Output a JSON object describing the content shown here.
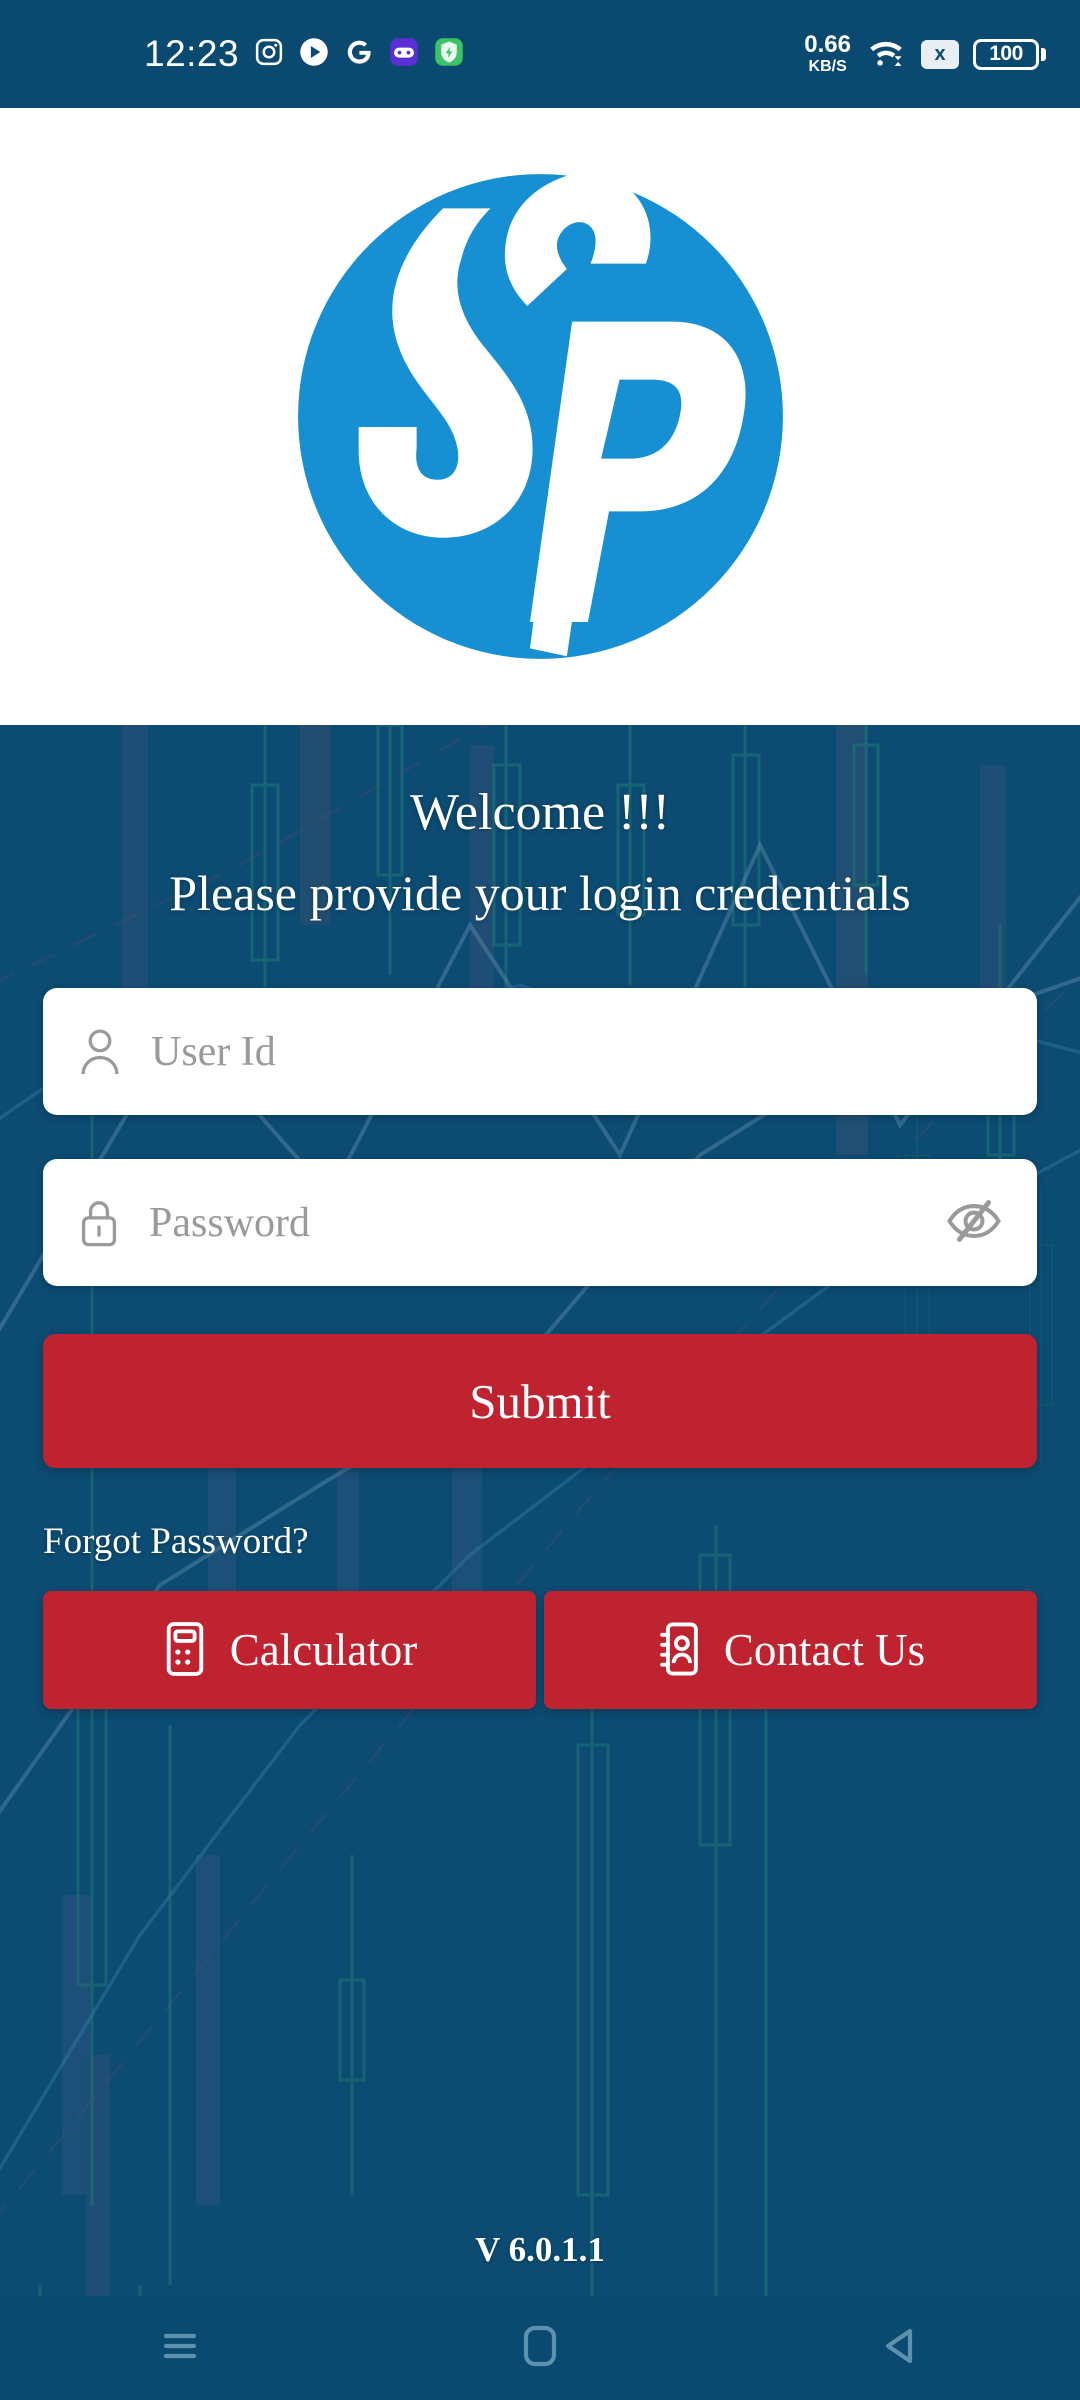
{
  "status_bar": {
    "time": "12:23",
    "left_icons": [
      {
        "name": "instagram-icon",
        "label": "Instagram"
      },
      {
        "name": "play-icon",
        "label": "Play"
      },
      {
        "name": "google-icon",
        "label": "Google"
      },
      {
        "name": "game-controller-icon",
        "label": "Game Controller"
      },
      {
        "name": "shield-bolt-icon",
        "label": "Security Booster"
      }
    ],
    "network_speed_value": "0.66",
    "network_speed_unit": "KB/S",
    "wifi_icon": "wifi-icon",
    "sim_icon_label": "x",
    "battery_level": "100"
  },
  "logo": {
    "name": "sp-logo",
    "alt": "SP",
    "circle_color": "#1690d3",
    "mark_color": "#ffffff"
  },
  "header": {
    "welcome": "Welcome !!!",
    "subtitle": "Please provide your login credentials"
  },
  "form": {
    "user_id": {
      "placeholder": "User Id",
      "value": "",
      "icon": "person-icon"
    },
    "password": {
      "placeholder": "Password",
      "value": "",
      "icon": "lock-icon",
      "toggle_icon": "eye-slash-icon",
      "visible": false
    },
    "submit_label": "Submit",
    "forgot_password_label": "Forgot Password?"
  },
  "actions": [
    {
      "label": "Calculator",
      "icon": "calculator-icon"
    },
    {
      "label": "Contact Us",
      "icon": "contact-book-icon"
    }
  ],
  "footer": {
    "version": "V 6.0.1.1"
  },
  "nav_bar": [
    {
      "name": "recents-button",
      "icon": "menu-lines-icon"
    },
    {
      "name": "home-button",
      "icon": "rounded-square-icon"
    },
    {
      "name": "back-button",
      "icon": "triangle-left-icon"
    }
  ],
  "theme": {
    "background": "#0c4b72",
    "status_bar_bg": "#0a4a70",
    "accent_red": "#bf2330",
    "logo_blue": "#1690d3",
    "panel_white": "#ffffff",
    "candle_green": "#2e9e72",
    "candle_purple": "#6b6a9e",
    "trend_line": "#a9c9de"
  }
}
